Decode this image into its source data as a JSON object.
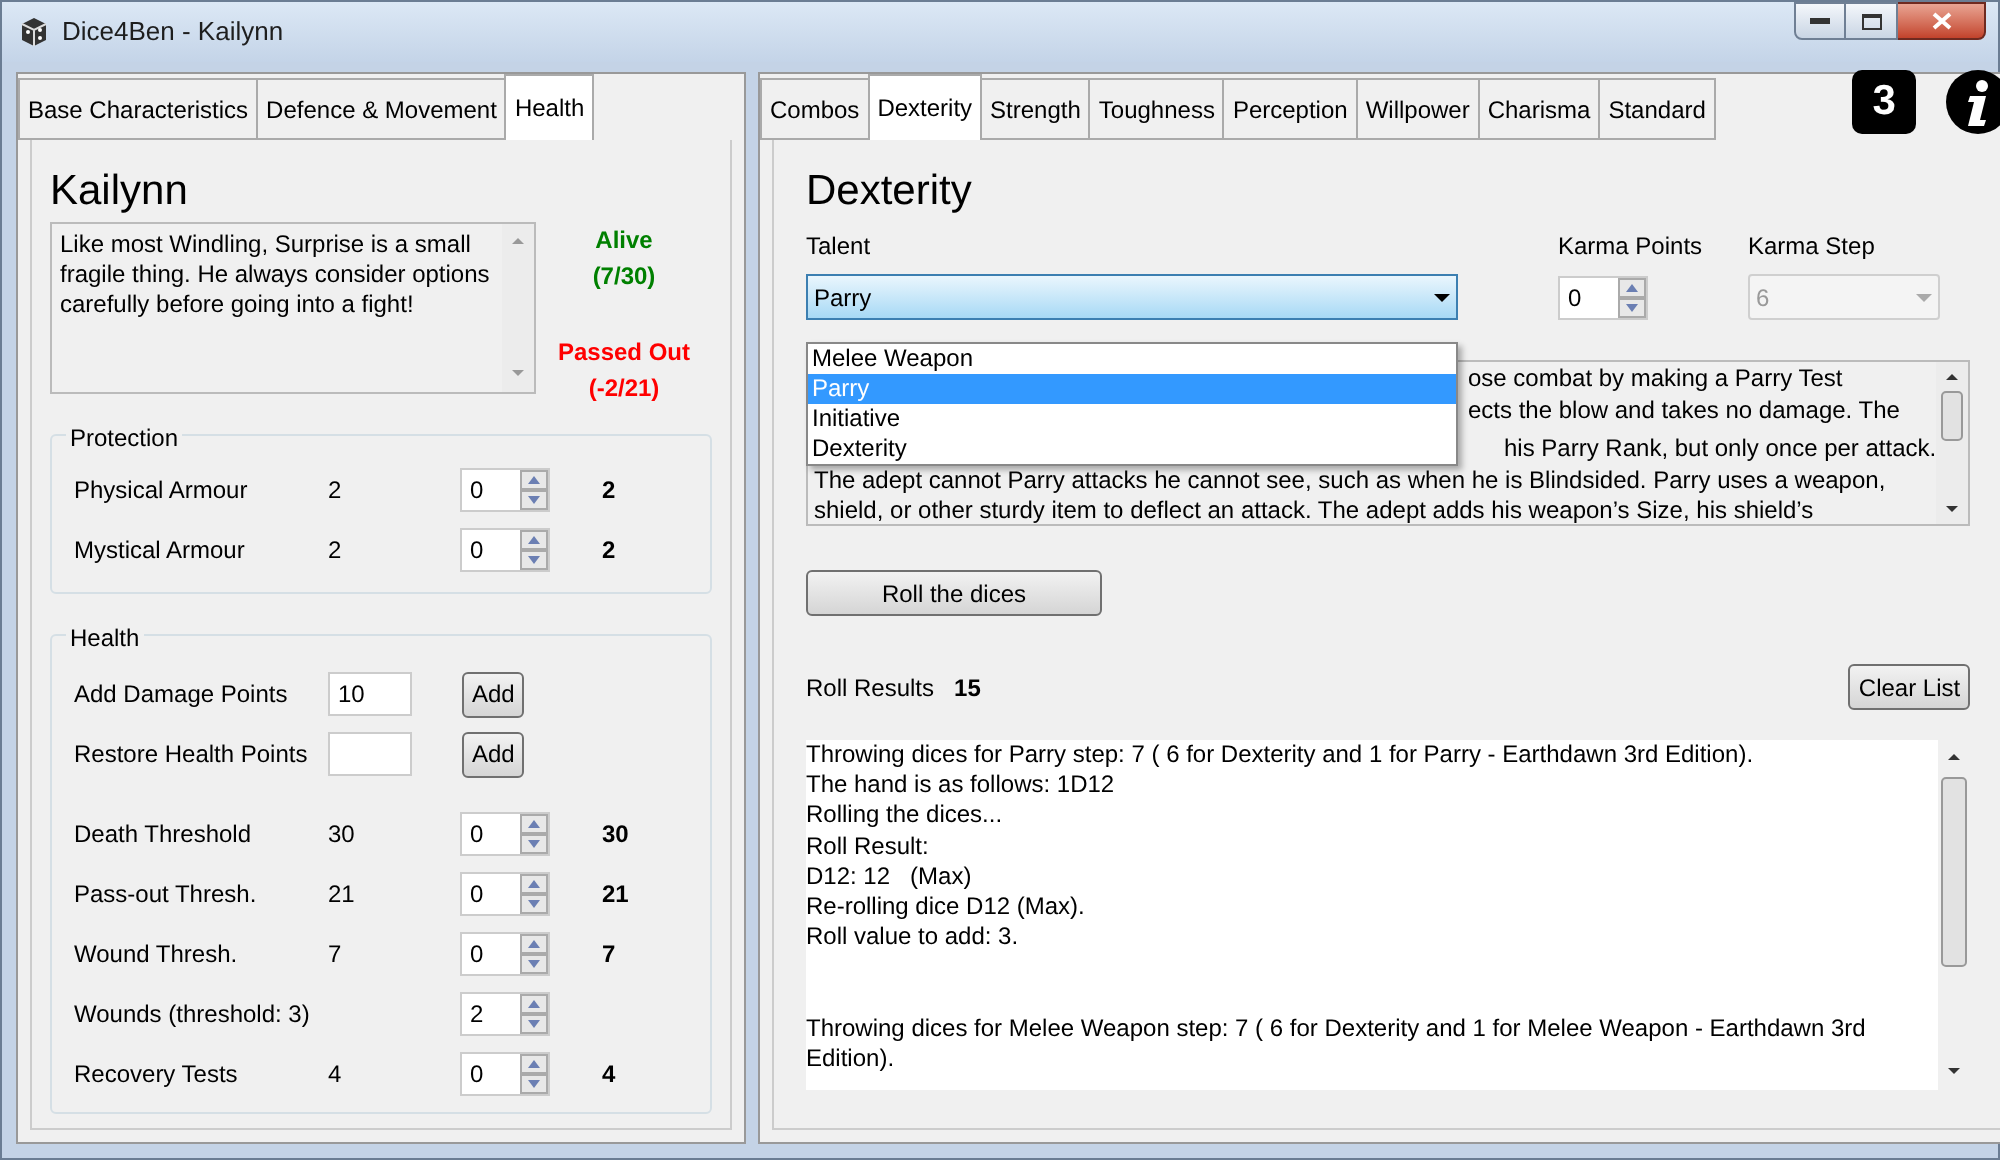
{
  "window": {
    "title": "Dice4Ben - Kailynn"
  },
  "left_tabs": [
    {
      "label": "Base Characteristics",
      "selected": false
    },
    {
      "label": "Defence & Movement",
      "selected": false
    },
    {
      "label": "Health",
      "selected": true
    }
  ],
  "character": {
    "name": "Kailynn",
    "description": "Like most Windling, Surprise is a small fragile thing. He always consider options carefully before going into a fight!",
    "status": [
      {
        "label": "Alive",
        "value": "(7/30)",
        "color": "#008000"
      },
      {
        "label": "Passed Out",
        "value": "(-2/21)",
        "color": "#ff0000"
      }
    ]
  },
  "protection": {
    "title": "Protection",
    "rows": [
      {
        "label": "Physical Armour",
        "base": "2",
        "modifier": "0",
        "total": "2"
      },
      {
        "label": "Mystical Armour",
        "base": "2",
        "modifier": "0",
        "total": "2"
      }
    ]
  },
  "health": {
    "title": "Health",
    "actions": [
      {
        "label": "Add Damage Points",
        "value": "10",
        "button": "Add"
      },
      {
        "label": "Restore Health Points",
        "button": "Add"
      }
    ],
    "rows": [
      {
        "label": "Death Threshold",
        "base": "30",
        "modifier": "0",
        "total": "30"
      },
      {
        "label": "Pass-out Thresh.",
        "base": "21",
        "modifier": "0",
        "total": "21"
      },
      {
        "label": "Wound Thresh.",
        "base": "7",
        "modifier": "0",
        "total": "7"
      },
      {
        "label": "Wounds (threshold: 3)",
        "modifier": "2"
      },
      {
        "label": "Recovery Tests",
        "base": "4",
        "modifier": "0",
        "total": "4"
      }
    ]
  },
  "right_tabs": [
    {
      "label": "Combos",
      "selected": false
    },
    {
      "label": "Dexterity",
      "selected": true
    },
    {
      "label": "Strength",
      "selected": false
    },
    {
      "label": "Toughness",
      "selected": false
    },
    {
      "label": "Perception",
      "selected": false
    },
    {
      "label": "Willpower",
      "selected": false
    },
    {
      "label": "Charisma",
      "selected": false
    },
    {
      "label": "Standard",
      "selected": false
    }
  ],
  "step_badge": "3",
  "dexterity": {
    "title": "Dexterity",
    "talent_label": "Talent",
    "talent": "Parry",
    "expanded": true,
    "options": [
      {
        "label": "Melee Weapon",
        "selected": false
      },
      {
        "label": "Parry",
        "selected": true
      },
      {
        "label": "Initiative",
        "selected": false
      },
      {
        "label": "Dexterity",
        "selected": false
      }
    ],
    "karma_points_label": "Karma Points",
    "karma_points": "0",
    "karma_step_label": "Karma Step",
    "karma_step": "6",
    "karma_step_disabled": true,
    "description_lines": [
      "ose combat by making a Parry Test",
      "ects the blow and takes no damage. The",
      "his Parry Rank, but only once per attack.",
      "The adept cannot Parry attacks he cannot see, such as when he is Blindsided. Parry uses a weapon,",
      "shield, or other sturdy item to deflect an attack. The adept adds his weapon’s Size, his shield’s"
    ],
    "roll_button": "Roll the dices",
    "roll_results_label": "Roll Results",
    "roll_results_value": "15",
    "clear_button": "Clear List",
    "log_entries": [
      [
        "Throwing dices for Parry step: 7 ( 6 for Dexterity and 1 for Parry - Earthdawn 3rd Edition).",
        "The hand is as follows: 1D12",
        "Rolling the dices...",
        "Roll Result:",
        "D12: 12   (Max)",
        "Re-rolling dice D12 (Max).",
        "Roll value to add: 3."
      ],
      [
        "Throwing dices for Melee Weapon step: 7 ( 6 for Dexterity and 1 for Melee Weapon - Earthdawn 3rd Edition)."
      ]
    ]
  }
}
